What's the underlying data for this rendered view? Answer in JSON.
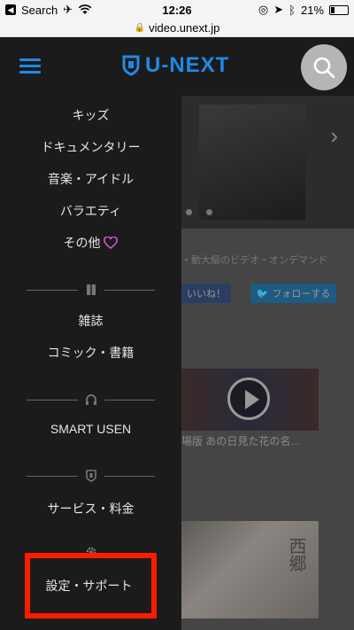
{
  "status_bar": {
    "back_label": "Search",
    "time": "12:26",
    "battery": "21%"
  },
  "url_bar": {
    "url": "video.unext.jp"
  },
  "header": {
    "logo_text": "U-NEXT"
  },
  "colors": {
    "accent": "#1e8ae8",
    "highlight": "#ff1a00",
    "heart": "#e05bd6"
  },
  "drawer": {
    "group1": [
      "キッズ",
      "ドキュメンタリー",
      "音楽・アイドル",
      "バラエティ"
    ],
    "other_label": "その他",
    "group2": [
      "雑誌",
      "コミック・書籍"
    ],
    "smart_usen": "SMART USEN",
    "service": "サービス・料金",
    "support": "設定・サポート"
  },
  "background": {
    "description_text": "・動大級のビデオ・オンデマンド",
    "like_label": "いいね！",
    "follow_label": "フォローする",
    "thumb1_caption": "場版 あの日見た花の名…",
    "thumb2_title": "西郷"
  }
}
